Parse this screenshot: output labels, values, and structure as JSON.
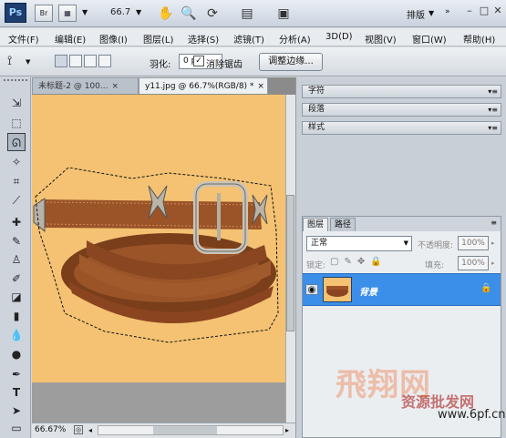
{
  "appbar": {
    "logo": "Ps",
    "bridge": "Br",
    "zoom": "66.7",
    "workspace": "排版",
    "icons": [
      "hand-icon",
      "zoom-icon",
      "rotate-view-icon",
      "arrange-documents-icon",
      "screen-mode-icon"
    ]
  },
  "menubar": {
    "items": [
      "文件(F)",
      "编辑(E)",
      "图像(I)",
      "图层(L)",
      "选择(S)",
      "滤镜(T)",
      "分析(A)",
      "3D(D)",
      "视图(V)",
      "窗口(W)",
      "帮助(H)"
    ]
  },
  "options": {
    "feather_label": "羽化:",
    "feather_value": "0 px",
    "antialias_label": "消除锯齿",
    "antialias_checked": true,
    "refine_edge": "调整边缘..."
  },
  "tabs": [
    {
      "label": "未标题-2 @ 100...",
      "active": false
    },
    {
      "label": "y11.jpg @ 66.7%(RGB/8) *",
      "active": true
    }
  ],
  "status": {
    "zoom": "66.67%"
  },
  "panels": {
    "character": "字符",
    "paragraph": "段落",
    "styles": "样式"
  },
  "layers": {
    "tab_layers": "图层",
    "tab_paths": "路径",
    "blend_mode": "正常",
    "opacity_label": "不透明度:",
    "opacity": "100%",
    "lock_label": "锁定:",
    "fill_label": "填充:",
    "fill": "100%",
    "layer_name": "背景"
  },
  "watermark": {
    "main": "飛翔网",
    "sub": "资源批发网",
    "url": "www.6pf.cn"
  },
  "colors": {
    "canvas": "#f4c272",
    "belt": "#8b4a22",
    "selection": "#3b8fe8"
  }
}
